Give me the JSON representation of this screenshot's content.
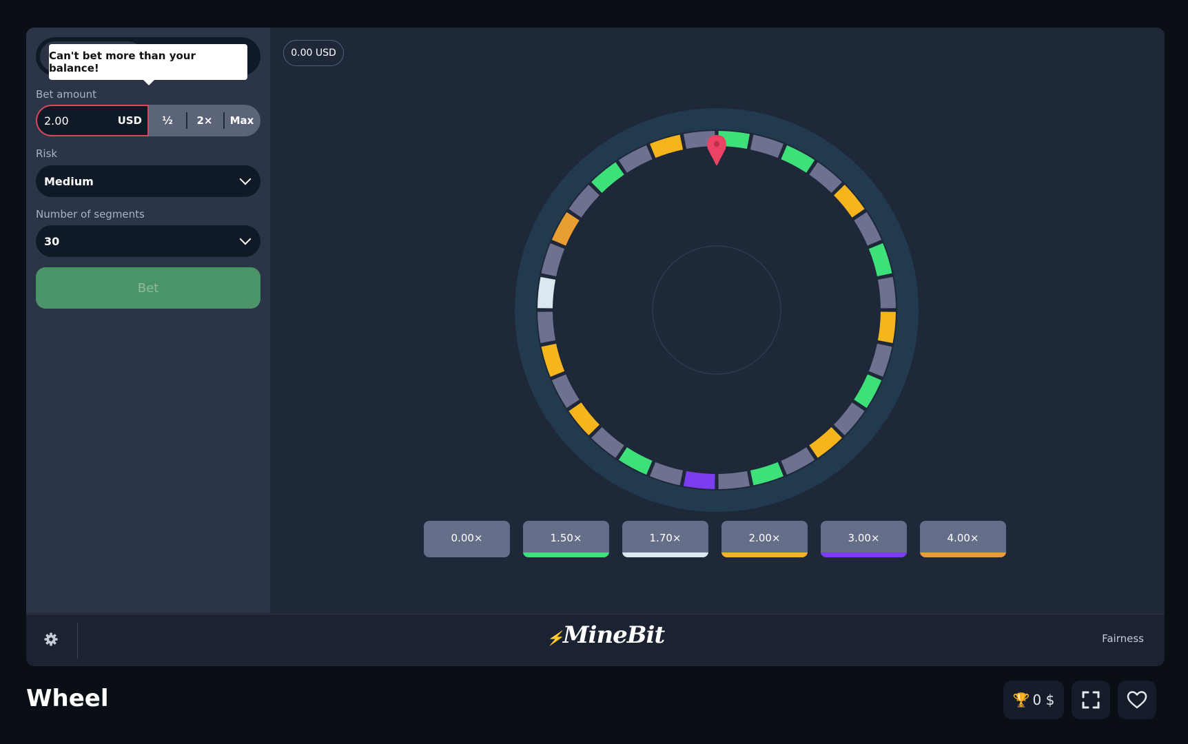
{
  "tooltip": "Can't bet more than your balance!",
  "bet": {
    "label": "Bet amount",
    "value": "2.00",
    "currency": "USD",
    "half": "½",
    "double": "2×",
    "max": "Max"
  },
  "risk": {
    "label": "Risk",
    "value": "Medium"
  },
  "segments": {
    "label": "Number of segments",
    "value": "30"
  },
  "bet_button": "Bet",
  "balance": "0.00 USD",
  "wheel": {
    "segment_colors": [
      "green",
      "gray",
      "green",
      "gray",
      "orange",
      "gray",
      "green",
      "gray",
      "orange",
      "gray",
      "green",
      "gray",
      "orange",
      "gray",
      "green",
      "gray",
      "purple",
      "gray",
      "green",
      "gray",
      "orange",
      "gray",
      "orange",
      "gray",
      "white",
      "gray",
      "amber",
      "gray",
      "green",
      "gray",
      "orange",
      "gray"
    ],
    "palette": {
      "green": "#3ee07a",
      "gray": "#6c7290",
      "orange": "#f6b51d",
      "amber": "#e89e30",
      "purple": "#7c3cf0",
      "white": "#dbe8ef"
    }
  },
  "multipliers": [
    {
      "label": "0.00×",
      "color": ""
    },
    {
      "label": "1.50×",
      "color": "#3ee07a"
    },
    {
      "label": "1.70×",
      "color": "#dbe8ef"
    },
    {
      "label": "2.00×",
      "color": "#f6b51d"
    },
    {
      "label": "3.00×",
      "color": "#7c3cf0"
    },
    {
      "label": "4.00×",
      "color": "#e89e30"
    }
  ],
  "footer": {
    "logo": "MineBit",
    "fairness": "Fairness"
  },
  "page": {
    "title": "Wheel",
    "contest": "0 $"
  }
}
